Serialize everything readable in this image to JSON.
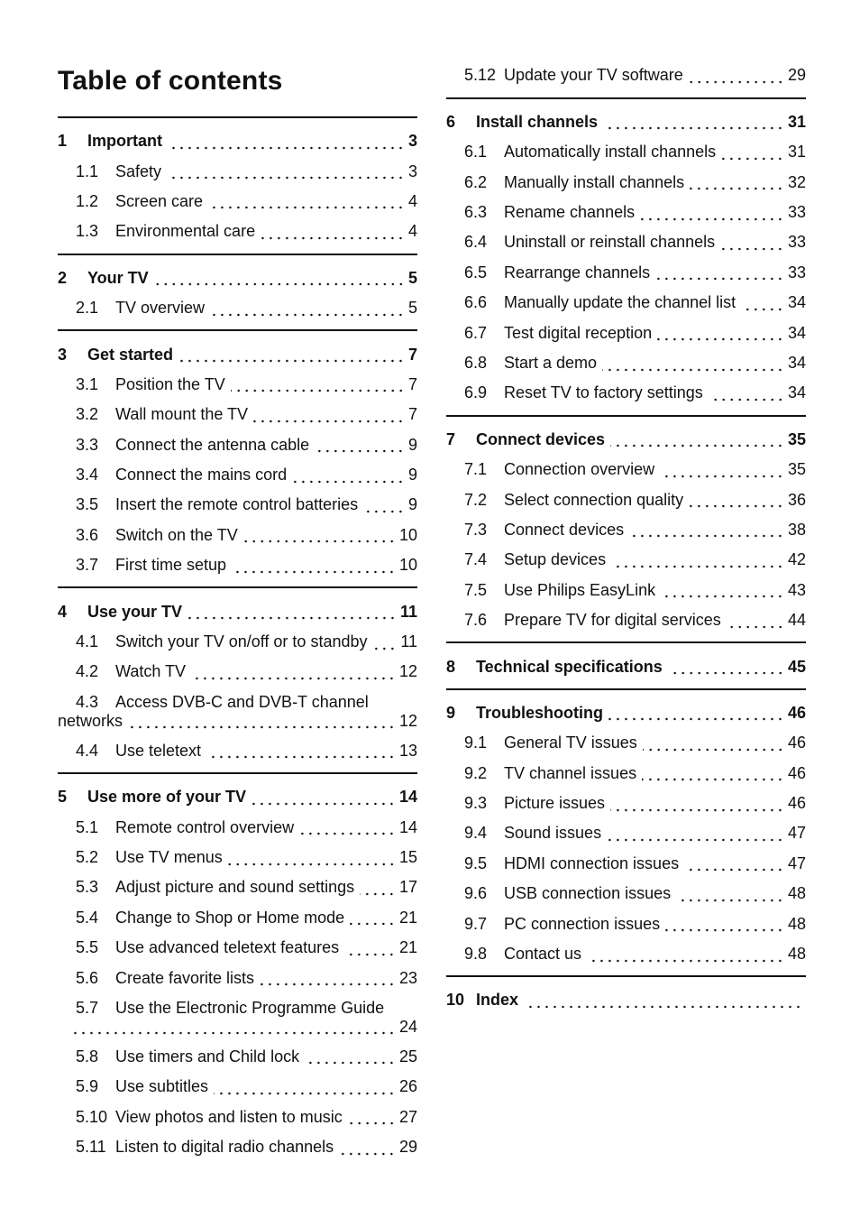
{
  "title": "Table of contents",
  "left_column": [
    {
      "num": "1",
      "title": "Important",
      "page": "3",
      "items": [
        {
          "num": "1.1",
          "title": "Safety",
          "page": "3"
        },
        {
          "num": "1.2",
          "title": "Screen care",
          "page": "4"
        },
        {
          "num": "1.3",
          "title": "Environmental care",
          "page": "4"
        }
      ]
    },
    {
      "num": "2",
      "title": "Your TV",
      "page": "5",
      "items": [
        {
          "num": "2.1",
          "title": "TV overview",
          "page": "5"
        }
      ]
    },
    {
      "num": "3",
      "title": "Get started",
      "page": "7",
      "items": [
        {
          "num": "3.1",
          "title": "Position the TV",
          "page": "7"
        },
        {
          "num": "3.2",
          "title": "Wall mount the TV",
          "page": "7"
        },
        {
          "num": "3.3",
          "title": "Connect the antenna cable",
          "page": "9"
        },
        {
          "num": "3.4",
          "title": "Connect the mains cord",
          "page": "9"
        },
        {
          "num": "3.5",
          "title": "Insert the remote control batteries",
          "page": "9"
        },
        {
          "num": "3.6",
          "title": "Switch on the TV",
          "page": "10"
        },
        {
          "num": "3.7",
          "title": "First time setup",
          "page": "10"
        }
      ]
    },
    {
      "num": "4",
      "title": "Use your TV",
      "page": "11",
      "items": [
        {
          "num": "4.1",
          "title": "Switch your TV on/off or to standby",
          "page": "11"
        },
        {
          "num": "4.2",
          "title": "Watch TV",
          "page": "12"
        },
        {
          "num": "4.3",
          "title": "Access DVB-C and DVB-T channel",
          "cont": "networks",
          "page": "12"
        },
        {
          "num": "4.4",
          "title": "Use teletext",
          "page": "13"
        }
      ]
    },
    {
      "num": "5",
      "title": "Use more of your TV",
      "page": "14",
      "items": [
        {
          "num": "5.1",
          "title": "Remote control overview",
          "page": "14"
        },
        {
          "num": "5.2",
          "title": "Use TV menus",
          "page": "15"
        },
        {
          "num": "5.3",
          "title": "Adjust picture and sound settings",
          "page": "17"
        },
        {
          "num": "5.4",
          "title": "Change to Shop or Home mode",
          "page": "21"
        },
        {
          "num": "5.5",
          "title": "Use advanced teletext features",
          "page": "21"
        },
        {
          "num": "5.6",
          "title": "Create favorite lists",
          "page": "23"
        },
        {
          "num": "5.7",
          "title": "Use the Electronic Programme Guide",
          "cont": "",
          "page": "24"
        },
        {
          "num": "5.8",
          "title": "Use timers and Child lock",
          "page": "25"
        },
        {
          "num": "5.9",
          "title": "Use subtitles",
          "page": "26"
        },
        {
          "num": "5.10",
          "title": "View photos and listen to music",
          "page": "27"
        },
        {
          "num": "5.11",
          "title": "Listen to digital radio channels",
          "page": "29"
        }
      ]
    }
  ],
  "right_column": [
    {
      "continued": true,
      "items": [
        {
          "num": "5.12",
          "title": "Update your TV software",
          "page": "29"
        }
      ]
    },
    {
      "num": "6",
      "title": "Install channels",
      "page": "31",
      "items": [
        {
          "num": "6.1",
          "title": "Automatically install channels",
          "page": "31"
        },
        {
          "num": "6.2",
          "title": "Manually install channels",
          "page": "32"
        },
        {
          "num": "6.3",
          "title": "Rename channels",
          "page": "33"
        },
        {
          "num": "6.4",
          "title": "Uninstall or reinstall channels",
          "page": "33"
        },
        {
          "num": "6.5",
          "title": "Rearrange channels",
          "page": "33"
        },
        {
          "num": "6.6",
          "title": "Manually update the channel list",
          "page": "34"
        },
        {
          "num": "6.7",
          "title": "Test digital reception",
          "page": "34"
        },
        {
          "num": "6.8",
          "title": "Start a demo",
          "page": "34"
        },
        {
          "num": "6.9",
          "title": "Reset TV to factory settings",
          "page": "34"
        }
      ]
    },
    {
      "num": "7",
      "title": "Connect devices",
      "page": "35",
      "items": [
        {
          "num": "7.1",
          "title": "Connection overview",
          "page": "35"
        },
        {
          "num": "7.2",
          "title": "Select connection quality",
          "page": "36"
        },
        {
          "num": "7.3",
          "title": "Connect devices",
          "page": "38"
        },
        {
          "num": "7.4",
          "title": "Setup devices",
          "page": "42"
        },
        {
          "num": "7.5",
          "title": "Use Philips EasyLink",
          "page": "43"
        },
        {
          "num": "7.6",
          "title": "Prepare TV for digital services",
          "page": "44"
        }
      ]
    },
    {
      "num": "8",
      "title": "Technical specifications",
      "page": "45",
      "items": []
    },
    {
      "num": "9",
      "title": "Troubleshooting",
      "page": "46",
      "items": [
        {
          "num": "9.1",
          "title": "General TV issues",
          "page": "46"
        },
        {
          "num": "9.2",
          "title": "TV channel issues",
          "page": "46"
        },
        {
          "num": "9.3",
          "title": "Picture issues",
          "page": "46"
        },
        {
          "num": "9.4",
          "title": "Sound issues",
          "page": "47"
        },
        {
          "num": "9.5",
          "title": "HDMI connection issues",
          "page": "47"
        },
        {
          "num": "9.6",
          "title": "USB connection issues",
          "page": "48"
        },
        {
          "num": "9.7",
          "title": "PC connection issues",
          "page": "48"
        },
        {
          "num": "9.8",
          "title": "Contact us",
          "page": "48"
        }
      ]
    },
    {
      "num": "10",
      "title": "Index",
      "page": "",
      "items": []
    }
  ]
}
